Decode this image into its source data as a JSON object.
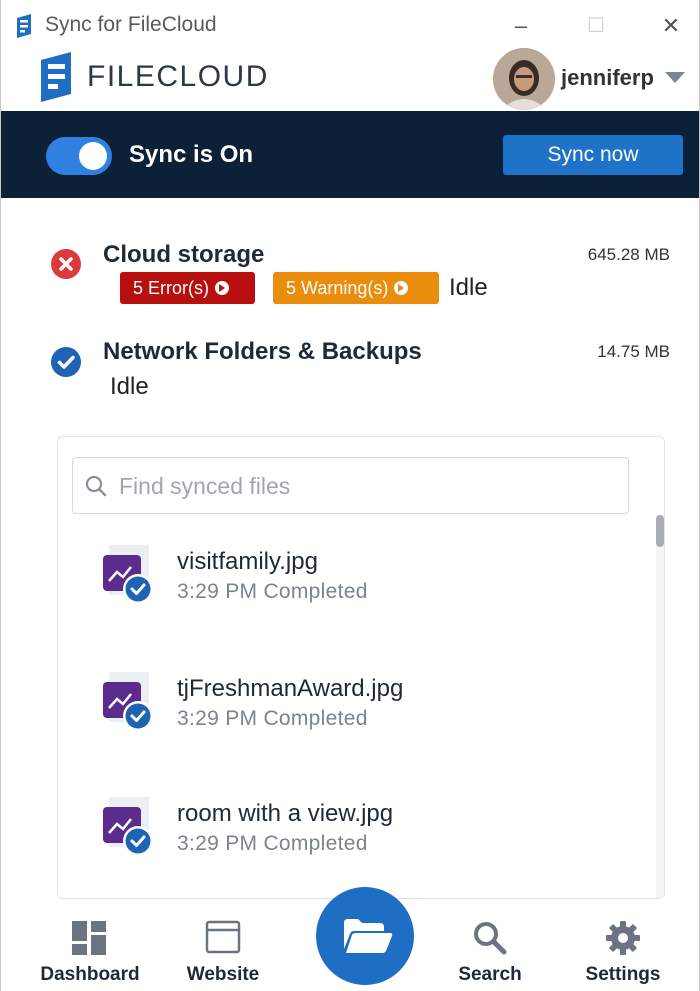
{
  "window": {
    "title": "Sync for FileCloud",
    "controls": {
      "minimize": "–",
      "maximize": "☐",
      "close": "✕"
    }
  },
  "brand": {
    "logo_text": "FILECLOUD"
  },
  "user": {
    "name": "jenniferp"
  },
  "sync": {
    "status_label": "Sync is On",
    "toggle_on": true,
    "sync_now_label": "Sync now"
  },
  "cloud_storage": {
    "title": "Cloud storage",
    "size": "645.28 MB",
    "errors_label": "5 Error(s)",
    "warnings_label": "5 Warning(s)",
    "state": "Idle",
    "status_icon": "error-circle-icon"
  },
  "network": {
    "title": "Network Folders & Backups",
    "size": "14.75 MB",
    "state": "Idle",
    "status_icon": "check-circle-icon"
  },
  "search": {
    "placeholder": "Find synced files",
    "value": ""
  },
  "files": [
    {
      "name": "visitfamily.jpg",
      "status": "3:29 PM Completed"
    },
    {
      "name": "tjFreshmanAward.jpg",
      "status": "3:29 PM Completed"
    },
    {
      "name": "room with a view.jpg",
      "status": "3:29 PM Completed"
    }
  ],
  "nav": {
    "dashboard": "Dashboard",
    "website": "Website",
    "search": "Search",
    "settings": "Settings",
    "center_icon": "folder-open-icon"
  },
  "colors": {
    "sync_bar": "#0c2137",
    "accent": "#1e73c9",
    "error": "#b80f0f",
    "warning": "#ea8d0c",
    "file_icon": "#5b2c8e"
  }
}
